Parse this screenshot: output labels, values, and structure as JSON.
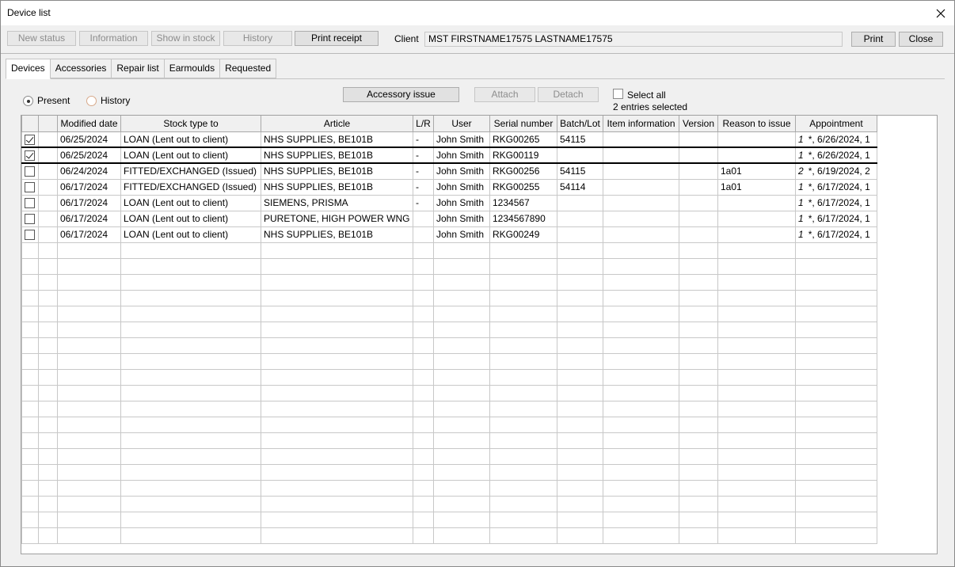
{
  "window": {
    "title": "Device list"
  },
  "toolbar": {
    "new_status": "New status",
    "information": "Information",
    "show_in_stock": "Show in stock",
    "history": "History",
    "print_receipt": "Print receipt",
    "client_label": "Client",
    "client_value": "MST FIRSTNAME17575 LASTNAME17575",
    "print": "Print",
    "close": "Close"
  },
  "tabs": [
    "Devices",
    "Accessories",
    "Repair list",
    "Earmoulds",
    "Requested"
  ],
  "filters": {
    "present_label": "Present",
    "history_label": "History",
    "accessory_issue": "Accessory issue",
    "attach": "Attach",
    "detach": "Detach",
    "select_all_label": "Select all",
    "entries_selected": "2 entries selected"
  },
  "table": {
    "columns": [
      "",
      "",
      "Modified date",
      "Stock type to",
      "Article",
      "L/R",
      "User",
      "Serial number",
      "Batch/Lot",
      "Item information",
      "Version",
      "Reason to issue",
      "Appointment"
    ],
    "rows": [
      {
        "checked": true,
        "date": "06/25/2024",
        "stock": "LOAN (Lent out to client)",
        "article": "NHS SUPPLIES, BE101B",
        "lr": "-",
        "user": "John Smith",
        "serial": "RKG00265",
        "batch": "54115",
        "info": "",
        "version": "",
        "reason": "",
        "apt_prefix": "1",
        "appointment": "*, 6/26/2024, 1"
      },
      {
        "checked": true,
        "date": "06/25/2024",
        "stock": "LOAN (Lent out to client)",
        "article": "NHS SUPPLIES, BE101B",
        "lr": "-",
        "user": "John Smith",
        "serial": "RKG00119",
        "batch": "",
        "info": "",
        "version": "",
        "reason": "",
        "apt_prefix": "1",
        "appointment": "*, 6/26/2024, 1"
      },
      {
        "checked": false,
        "date": "06/24/2024",
        "stock": "FITTED/EXCHANGED (Issued)",
        "article": "NHS SUPPLIES, BE101B",
        "lr": "-",
        "user": "John Smith",
        "serial": "RKG00256",
        "batch": "54115",
        "info": "",
        "version": "",
        "reason": "1a01",
        "apt_prefix": "2",
        "appointment": "*, 6/19/2024, 2"
      },
      {
        "checked": false,
        "date": "06/17/2024",
        "stock": "FITTED/EXCHANGED (Issued)",
        "article": "NHS SUPPLIES, BE101B",
        "lr": "-",
        "user": "John Smith",
        "serial": "RKG00255",
        "batch": "54114",
        "info": "",
        "version": "",
        "reason": "1a01",
        "apt_prefix": "1",
        "appointment": "*, 6/17/2024, 1"
      },
      {
        "checked": false,
        "date": "06/17/2024",
        "stock": "LOAN (Lent out to client)",
        "article": "SIEMENS, PRISMA",
        "lr": "-",
        "user": "John Smith",
        "serial": "1234567",
        "batch": "",
        "info": "",
        "version": "",
        "reason": "",
        "apt_prefix": "1",
        "appointment": "*, 6/17/2024, 1"
      },
      {
        "checked": false,
        "date": "06/17/2024",
        "stock": "LOAN (Lent out to client)",
        "article": "PURETONE, HIGH POWER WNG",
        "lr": "",
        "user": "John Smith",
        "serial": "1234567890",
        "batch": "",
        "info": "",
        "version": "",
        "reason": "",
        "apt_prefix": "1",
        "appointment": "*, 6/17/2024, 1"
      },
      {
        "checked": false,
        "date": "06/17/2024",
        "stock": "LOAN (Lent out to client)",
        "article": "NHS SUPPLIES, BE101B",
        "lr": "",
        "user": "John Smith",
        "serial": "RKG00249",
        "batch": "",
        "info": "",
        "version": "",
        "reason": "",
        "apt_prefix": "1",
        "appointment": "*, 6/17/2024, 1"
      }
    ]
  }
}
